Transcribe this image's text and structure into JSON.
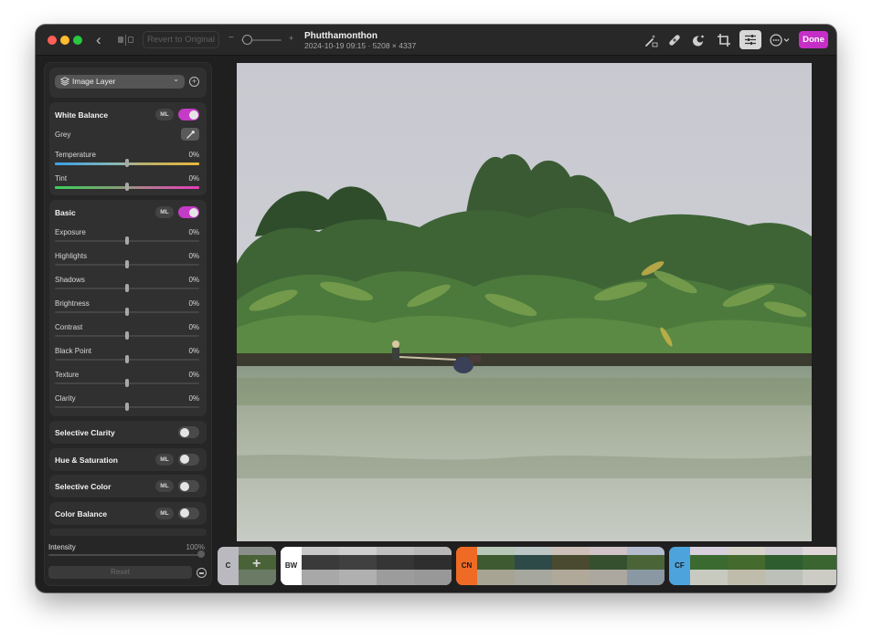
{
  "window": {
    "back_label": "‹",
    "revert_label": "Revert to Original",
    "zoom_minus": "−",
    "zoom_plus": "+",
    "zoom_level": 0.05,
    "title": "Phutthamonthon",
    "meta": "2024-10-19 09:15 · 5208 × 4337",
    "done_label": "Done",
    "accent": "#c52fc7",
    "toolbar_icons": [
      "magic-wand-icon",
      "bandage-icon",
      "mask-icon",
      "crop-icon",
      "adjust-sliders-icon",
      "more-icon"
    ]
  },
  "sidebar": {
    "layer": {
      "label": "Image Layer"
    },
    "white_balance": {
      "title": "White Balance",
      "ml": "ML",
      "enabled": true,
      "grey_label": "Grey",
      "rows": [
        {
          "label": "Temperature",
          "value": "0%"
        },
        {
          "label": "Tint",
          "value": "0%"
        }
      ]
    },
    "basic": {
      "title": "Basic",
      "ml": "ML",
      "enabled": true,
      "rows": [
        {
          "label": "Exposure",
          "value": "0%"
        },
        {
          "label": "Highlights",
          "value": "0%"
        },
        {
          "label": "Shadows",
          "value": "0%"
        },
        {
          "label": "Brightness",
          "value": "0%"
        },
        {
          "label": "Contrast",
          "value": "0%"
        },
        {
          "label": "Black Point",
          "value": "0%"
        },
        {
          "label": "Texture",
          "value": "0%"
        },
        {
          "label": "Clarity",
          "value": "0%"
        }
      ]
    },
    "sections": [
      {
        "title": "Selective Clarity",
        "ml": "",
        "enabled": false
      },
      {
        "title": "Hue & Saturation",
        "ml": "ML",
        "enabled": false
      },
      {
        "title": "Selective Color",
        "ml": "ML",
        "enabled": false
      },
      {
        "title": "Color Balance",
        "ml": "ML",
        "enabled": false
      }
    ],
    "intensity": {
      "label": "Intensity",
      "value": "100%",
      "fraction": 1.0
    },
    "reset_label": "Reset"
  },
  "filmstrip": {
    "groups": [
      {
        "tag": "C",
        "color": "#b9b9bf",
        "text_color": "#222222",
        "count": 1,
        "plus": "+"
      },
      {
        "tag": "BW",
        "color": "#ffffff",
        "text_color": "#222222",
        "count": 4
      },
      {
        "tag": "CN",
        "color": "#ef6a25",
        "text_color": "#1a1a1a",
        "count": 5
      },
      {
        "tag": "CF",
        "color": "#4da3dc",
        "text_color": "#1a1a1a",
        "count": 4
      }
    ]
  }
}
